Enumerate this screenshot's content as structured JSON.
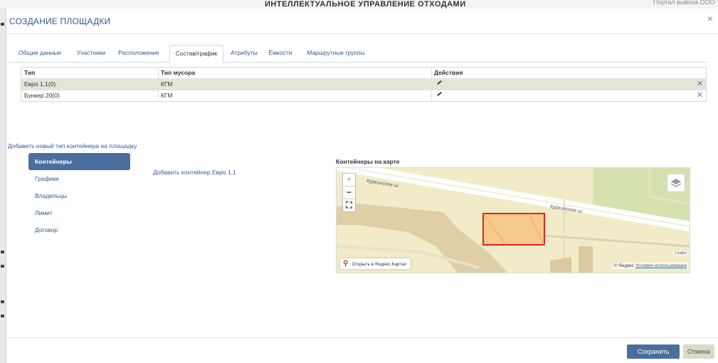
{
  "background": {
    "app_title": "ИНТЕЛЛЕКТУАЛЬНОЕ УПРАВЛЕНИЕ ОТХОДАМИ",
    "top_right": "Портал вывоза ООО \"Эл"
  },
  "modal": {
    "title": "СОЗДАНИЕ ПЛОЩАДКИ",
    "close": "×"
  },
  "tabs": [
    {
      "label": "Общие данные"
    },
    {
      "label": "Участники"
    },
    {
      "label": "Расположение"
    },
    {
      "label": "Состав/график",
      "active": true
    },
    {
      "label": "Атрибуты"
    },
    {
      "label": "Ёмкости"
    },
    {
      "label": "Маршрутные группы"
    }
  ],
  "table": {
    "headers": [
      "Тип",
      "Тип мусора",
      "Действия"
    ],
    "rows": [
      {
        "type": "Евро 1,1(0)",
        "waste": "КГМ"
      },
      {
        "type": "Бункер 20(0)",
        "waste": "КГМ"
      }
    ],
    "delete_glyph": "✕"
  },
  "add_container_type_link": "Добавить новый тип контейнера на площадку",
  "sidenav": [
    {
      "label": "Контейнеры",
      "active": true
    },
    {
      "label": "Графики"
    },
    {
      "label": "Владельцы"
    },
    {
      "label": "Лимит"
    },
    {
      "label": "Договор"
    }
  ],
  "add_container_link": "Добавить контейнер Евро 1,1",
  "map": {
    "title": "Контейнеры на карте",
    "zoom_in": "+",
    "zoom_out": "−",
    "fullscreen": "⛶",
    "street_label_1": "Куркинское ш.",
    "street_label_2": "Куркинское ш.",
    "open_in_yandex": "Открыть в Яндекс.Картах",
    "leaflet": "Leaflet",
    "copyright_prefix": "© Яндекс",
    "terms_link": "Условия использования",
    "colors": {
      "highlight_fill": "#f7c98a",
      "highlight_border": "#e02020",
      "land": "#f1ebc8"
    }
  },
  "buttons": {
    "save": "Сохранить",
    "cancel": "Отмена"
  }
}
